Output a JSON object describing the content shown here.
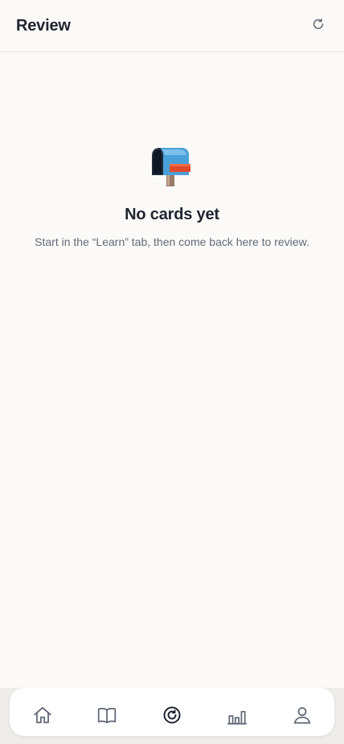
{
  "header": {
    "title": "Review",
    "refresh_icon": "refresh-icon"
  },
  "empty_state": {
    "icon": "mailbox-icon",
    "title": "No cards yet",
    "message": "Start in the “Learn” tab, then come back here to review."
  },
  "tab_bar": {
    "items": [
      {
        "icon": "home-icon"
      },
      {
        "icon": "book-icon"
      },
      {
        "icon": "review-icon",
        "active": true
      },
      {
        "icon": "stats-icon"
      },
      {
        "icon": "profile-icon"
      }
    ]
  },
  "colors": {
    "background": "#fbfaf8",
    "text_primary": "#1f2430",
    "text_secondary": "#626a78",
    "icon": "#5f6675",
    "icon_active": "#1f2430"
  }
}
